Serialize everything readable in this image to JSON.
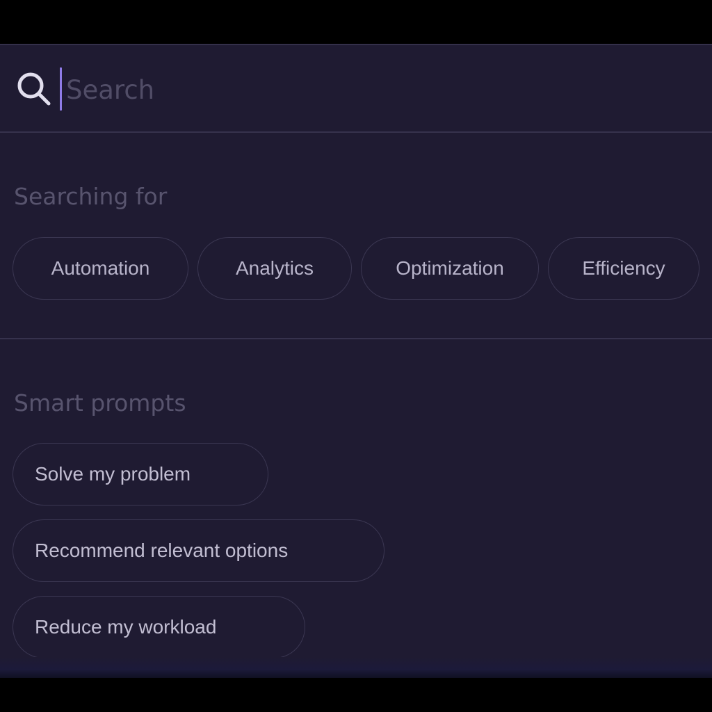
{
  "search": {
    "placeholder": "Search",
    "value": ""
  },
  "searching_for": {
    "title": "Searching for",
    "chips": [
      "Automation",
      "Analytics",
      "Optimization",
      "Efficiency"
    ]
  },
  "smart_prompts": {
    "title": "Smart prompts",
    "items": [
      "Solve my problem",
      "Recommend relevant options",
      "Reduce my workload"
    ]
  },
  "icons": {
    "search": "search-icon"
  },
  "colors": {
    "panel_background": "#1f1b32",
    "caret_accent": "#8f7be8",
    "chip_border": "#3b3752",
    "section_title": "#58546e",
    "chip_text": "#b8b4ca"
  }
}
